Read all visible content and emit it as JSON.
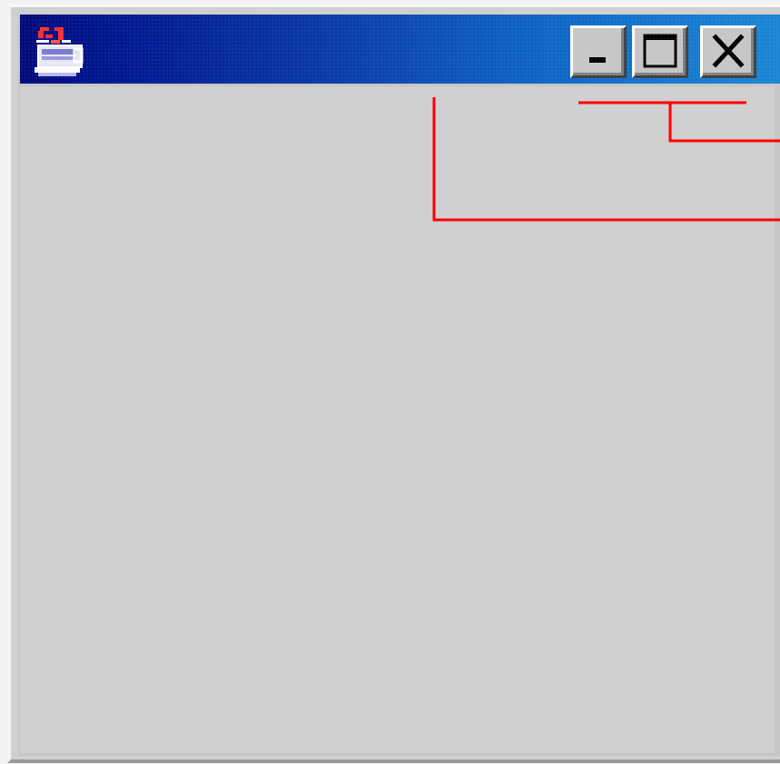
{
  "window": {
    "icons": {
      "app": "java-cup-icon",
      "minimize": "minimize-icon",
      "maximize": "maximize-icon",
      "close": "close-icon"
    },
    "colors": {
      "titlebar_start": "#000b7a",
      "titlebar_end": "#1a86d6",
      "client_background": "#d0d0d0",
      "callout_line": "#ff0000"
    }
  }
}
